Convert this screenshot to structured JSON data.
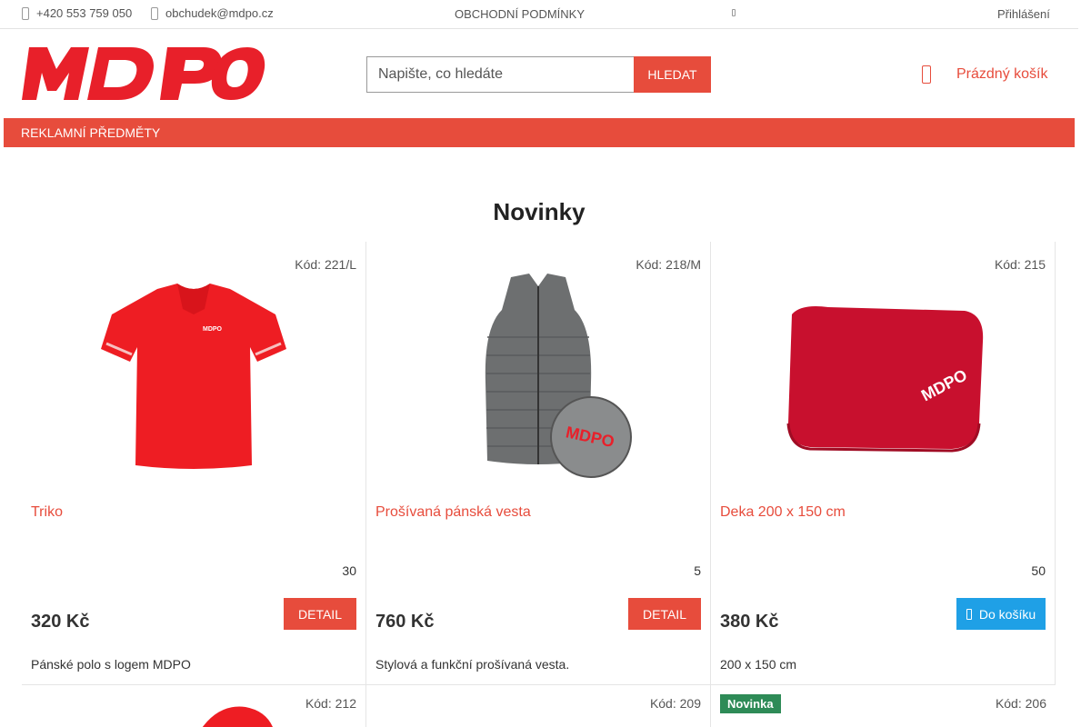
{
  "topbar": {
    "phone": "+420 553 759 050",
    "email": "obchudek@mdpo.cz",
    "terms": "OBCHODNÍ PODMÍNKY",
    "login": "Přihlášení"
  },
  "header": {
    "logo_text": "MDPO",
    "search_placeholder": "Napište, co hledáte",
    "search_button": "HLEDAT",
    "cart_label": "Prázdný košík"
  },
  "nav": {
    "items": [
      "REKLAMNÍ PŘEDMĚTY"
    ]
  },
  "section": {
    "title": "Novinky"
  },
  "products": [
    {
      "code": "Kód: 221/L",
      "name": "Triko",
      "stock": "30",
      "price": "320 Kč",
      "button": "DETAIL",
      "description": "Pánské polo s logem MDPO",
      "image": "red-polo-shirt"
    },
    {
      "code": "Kód: 218/M",
      "name": "Prošívaná pánská vesta",
      "stock": "5",
      "price": "760 Kč",
      "button": "DETAIL",
      "description": "Stylová a funkční prošívaná vesta.",
      "image": "grey-quilted-vest"
    },
    {
      "code": "Kód: 215",
      "name": "Deka 200 x 150 cm",
      "stock": "50",
      "price": "380 Kč",
      "button": "Do košíku",
      "description": "200 x 150 cm",
      "image": "red-blanket"
    }
  ],
  "products_row2": [
    {
      "code": "Kód: 212",
      "badge": ""
    },
    {
      "code": "Kód: 209",
      "badge": ""
    },
    {
      "code": "Kód: 206",
      "badge": "Novinka"
    }
  ],
  "colors": {
    "accent": "#e74c3c",
    "cart_button": "#1fa0e6",
    "badge_new": "#2e8b57"
  }
}
